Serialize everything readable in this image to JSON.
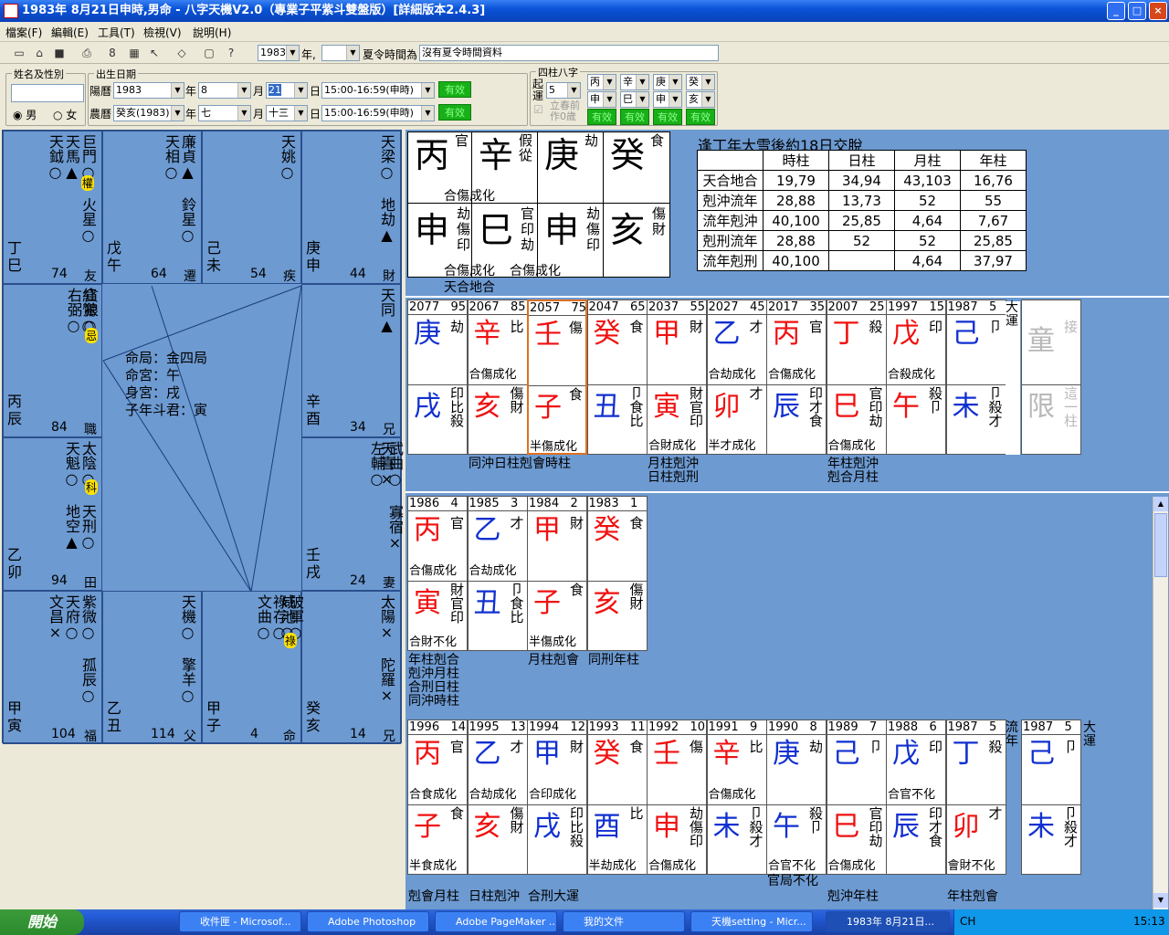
{
  "window": {
    "title": "1983年 8月21日申時,男命 - 八字天機V2.0（專業子平紫斗雙盤版）[詳細版本2.4.3]"
  },
  "menu": [
    "檔案(F)",
    "編輯(E)",
    "工具(T)",
    "檢視(V)",
    "說明(H)"
  ],
  "toolbar": {
    "year_value": "1983",
    "year_suffix": "年,",
    "dst_label": "夏令時間為",
    "dst_value": "沒有夏令時間資料"
  },
  "form": {
    "name_group": "姓名及性別",
    "birth_group": "出生日期",
    "gender_male": "男",
    "gender_female": "女",
    "solar_label": "陽曆",
    "solar_year": "1983",
    "solar_month": "8",
    "solar_day": "21",
    "solar_time": "15:00-16:59(申時)",
    "lunar_label": "農曆",
    "lunar_year": "癸亥(1983)",
    "lunar_month": "七",
    "lunar_day": "十三",
    "lunar_time": "15:00-16:59(申時)",
    "year_char": "年",
    "month_char": "月",
    "day_char": "日",
    "valid": "有效",
    "pillar_group": "四柱八字",
    "qiyun_label": "起運",
    "qiyun_value": "5",
    "lichun_label": "立春前",
    "zuo0_label": "作0歲",
    "pillars": [
      "丙",
      "辛",
      "庚",
      "癸",
      "申",
      "巳",
      "申",
      "亥"
    ]
  },
  "ziwei": {
    "center": [
      "命局：金四局",
      "命宮：午",
      "身宮：戌",
      "子年斗君：寅"
    ],
    "palaces": [
      {
        "stem": "丁巳",
        "num": "74",
        "name": "友",
        "stars": [
          "天鉞○",
          "天馬▲",
          "巨門○"
        ],
        "star2": "權",
        "star3": "火星○"
      },
      {
        "stem": "戊午",
        "num": "64",
        "name": "遷",
        "stars": [
          "天相○",
          "廉貞▲"
        ],
        "star3": "鈴星○"
      },
      {
        "stem": "己未",
        "num": "54",
        "name": "疾",
        "stars": [
          "天姚○"
        ]
      },
      {
        "stem": "庚申",
        "num": "44",
        "name": "財",
        "stars": [
          "天梁○"
        ],
        "star3": "地劫▲"
      },
      {
        "stem": "丙辰",
        "num": "84",
        "name": "職",
        "stars": [
          "紅鸞○"
        ]
      },
      {
        "stem": "辛酉",
        "num": "34",
        "name": "兄",
        "stars": [
          "天同▲"
        ]
      },
      {
        "stem": "乙卯",
        "num": "94",
        "name": "田",
        "stars": [
          "天魁○",
          "太陰○"
        ],
        "star3": "天刑○",
        "star4": "地空▲"
      },
      {
        "stem": "壬戌",
        "num": "24",
        "name": "妻",
        "stars": [
          "天喜×"
        ]
      },
      {
        "stem": "甲寅",
        "num": "104",
        "name": "福",
        "stars": [
          "文昌×",
          "天府○",
          "紫微○"
        ],
        "star3": "孤辰○"
      },
      {
        "stem": "乙丑",
        "num": "114",
        "name": "父",
        "stars": [
          "天機○"
        ],
        "star3": "擎羊○"
      },
      {
        "stem": "甲子",
        "num": "4",
        "name": "命",
        "stars": [
          "咸池○"
        ]
      },
      {
        "stem": "癸亥",
        "num": "14",
        "name": "兄",
        "stars": [
          "太陽×"
        ],
        "star3": "陀羅×"
      }
    ],
    "extra": {
      "youbi": "右弼○",
      "tanlang": "貪狼○",
      "ji": "忌",
      "ke": "科",
      "lu": "祿",
      "wuqu": "武曲○",
      "zuofu": "左輔○",
      "guashu": "寡宿×",
      "wenqu": "文曲○",
      "lucun": "祿存○",
      "pojun": "破軍○"
    }
  },
  "natal": {
    "top": [
      {
        "g": "丙",
        "s": "官"
      },
      {
        "g": "辛",
        "s": "假從"
      },
      {
        "g": "庚",
        "s": "劫"
      },
      {
        "g": "癸",
        "s": "食"
      }
    ],
    "bottom": [
      {
        "z": "申",
        "s": "劫傷印"
      },
      {
        "z": "巳",
        "s": "官印劫"
      },
      {
        "z": "申",
        "s": "劫傷印"
      },
      {
        "z": "亥",
        "s": "傷財"
      }
    ],
    "rel_top": "合傷成化",
    "rel_bottom1": "合傷成化",
    "rel_bottom2": "合傷成化",
    "note": "天合地合"
  },
  "jiaoyun": "逢丁年大雪後約18日交脫",
  "pillar_table": {
    "headers": [
      "",
      "時柱",
      "日柱",
      "月柱",
      "年柱"
    ],
    "rows": [
      [
        "天合地合",
        "19,79",
        "34,94",
        "43,103",
        "16,76"
      ],
      [
        "剋沖流年",
        "28,88",
        "13,73",
        "52",
        "55"
      ],
      [
        "流年剋沖",
        "40,100",
        "25,85",
        "4,64",
        "7,67"
      ],
      [
        "剋刑流年",
        "28,88",
        "52",
        "52",
        "25,85"
      ],
      [
        "流年剋刑",
        "40,100",
        "",
        "4,64",
        "37,97"
      ]
    ]
  },
  "dayun_label": "大運",
  "dayun": [
    {
      "y": "2077",
      "a": "95",
      "g": "庚",
      "gc": "blue",
      "s": "劫",
      "z": "戌",
      "zc": "blue",
      "h": "印比殺",
      "r1": "",
      "r2": ""
    },
    {
      "y": "2067",
      "a": "85",
      "g": "辛",
      "gc": "red",
      "s": "比",
      "z": "亥",
      "zc": "red",
      "h": "傷財",
      "r1": "合傷成化",
      "r2": ""
    },
    {
      "y": "2057",
      "a": "75",
      "g": "壬",
      "gc": "red",
      "s": "傷",
      "z": "子",
      "zc": "red",
      "h": "食",
      "r1": "",
      "r2": "半傷成化"
    },
    {
      "y": "2047",
      "a": "65",
      "g": "癸",
      "gc": "red",
      "s": "食",
      "z": "丑",
      "zc": "blue",
      "h": "卩食比",
      "r1": "",
      "r2": ""
    },
    {
      "y": "2037",
      "a": "55",
      "g": "甲",
      "gc": "red",
      "s": "財",
      "z": "寅",
      "zc": "red",
      "h": "財官印",
      "r1": "",
      "r2": "合財成化"
    },
    {
      "y": "2027",
      "a": "45",
      "g": "乙",
      "gc": "blue",
      "s": "才",
      "z": "卯",
      "zc": "red",
      "h": "才",
      "r1": "合劫成化",
      "r2": "半才成化"
    },
    {
      "y": "2017",
      "a": "35",
      "g": "丙",
      "gc": "red",
      "s": "官",
      "z": "辰",
      "zc": "blue",
      "h": "印才食",
      "r1": "合傷成化",
      "r2": ""
    },
    {
      "y": "2007",
      "a": "25",
      "g": "丁",
      "gc": "red",
      "s": "殺",
      "z": "巳",
      "zc": "red",
      "h": "官印劫",
      "r1": "",
      "r2": "合傷成化"
    },
    {
      "y": "1997",
      "a": "15",
      "g": "戊",
      "gc": "red",
      "s": "印",
      "z": "午",
      "zc": "red",
      "h": "殺卩",
      "r1": "合殺成化",
      "r2": ""
    },
    {
      "y": "1987",
      "a": "5",
      "g": "己",
      "gc": "blue",
      "s": "卩",
      "z": "未",
      "zc": "blue",
      "h": "卩殺才",
      "r1": "",
      "r2": ""
    }
  ],
  "dayun_tongxian": {
    "g": "童",
    "s": "接",
    "z": "限",
    "h": "這一柱"
  },
  "dayun_notes": [
    "同沖日柱剋會時柱",
    "月柱剋沖",
    "日柱剋刑",
    "年柱剋沖",
    "剋合月柱"
  ],
  "xiaoyun": [
    {
      "y": "1986",
      "a": "4",
      "g": "丙",
      "gc": "red",
      "s": "官",
      "z": "寅",
      "zc": "red",
      "h": "財官印",
      "r1": "合傷成化",
      "r2": "合財不化"
    },
    {
      "y": "1985",
      "a": "3",
      "g": "乙",
      "gc": "blue",
      "s": "才",
      "z": "丑",
      "zc": "blue",
      "h": "卩食比",
      "r1": "合劫成化",
      "r2": ""
    },
    {
      "y": "1984",
      "a": "2",
      "g": "甲",
      "gc": "red",
      "s": "財",
      "z": "子",
      "zc": "red",
      "h": "食",
      "r1": "",
      "r2": "半傷成化"
    },
    {
      "y": "1983",
      "a": "1",
      "g": "癸",
      "gc": "red",
      "s": "食",
      "z": "亥",
      "zc": "red",
      "h": "傷財",
      "r1": "",
      "r2": ""
    }
  ],
  "xiaoyun_notes": [
    "年柱剋合",
    "剋沖月柱",
    "合刑日柱",
    "同沖時柱",
    "月柱剋會",
    "同刑年柱"
  ],
  "liunian_label": "流年",
  "liunian": [
    {
      "y": "1996",
      "a": "14",
      "g": "丙",
      "gc": "red",
      "s": "官",
      "z": "子",
      "zc": "red",
      "h": "食",
      "r1": "合食成化",
      "r2": "半食成化"
    },
    {
      "y": "1995",
      "a": "13",
      "g": "乙",
      "gc": "blue",
      "s": "才",
      "z": "亥",
      "zc": "red",
      "h": "傷財",
      "r1": "合劫成化",
      "r2": ""
    },
    {
      "y": "1994",
      "a": "12",
      "g": "甲",
      "gc": "blue",
      "s": "財",
      "z": "戌",
      "zc": "blue",
      "h": "印比殺",
      "r1": "合印成化",
      "r2": ""
    },
    {
      "y": "1993",
      "a": "11",
      "g": "癸",
      "gc": "red",
      "s": "食",
      "z": "酉",
      "zc": "blue",
      "h": "比",
      "r1": "",
      "r2": "半劫成化"
    },
    {
      "y": "1992",
      "a": "10",
      "g": "壬",
      "gc": "red",
      "s": "傷",
      "z": "申",
      "zc": "red",
      "h": "劫傷印",
      "r1": "",
      "r2": "合傷成化"
    },
    {
      "y": "1991",
      "a": "9",
      "g": "辛",
      "gc": "red",
      "s": "比",
      "z": "未",
      "zc": "blue",
      "h": "卩殺才",
      "r1": "合傷成化",
      "r2": ""
    },
    {
      "y": "1990",
      "a": "8",
      "g": "庚",
      "gc": "blue",
      "s": "劫",
      "z": "午",
      "zc": "blue",
      "h": "殺卩",
      "r1": "",
      "r2": "合官不化"
    },
    {
      "y": "1989",
      "a": "7",
      "g": "己",
      "gc": "blue",
      "s": "卩",
      "z": "巳",
      "zc": "red",
      "h": "官印劫",
      "r1": "",
      "r2": "合傷成化"
    },
    {
      "y": "1988",
      "a": "6",
      "g": "戊",
      "gc": "blue",
      "s": "印",
      "z": "辰",
      "zc": "blue",
      "h": "印才食",
      "r1": "合官不化",
      "r2": ""
    },
    {
      "y": "1987",
      "a": "5",
      "g": "丁",
      "gc": "blue",
      "s": "殺",
      "z": "卯",
      "zc": "red",
      "h": "才",
      "r1": "",
      "r2": "會財不化"
    }
  ],
  "liunian_extra": {
    "y": "1987",
    "a": "5",
    "g": "己",
    "s": "卩",
    "z": "未",
    "h": "卩殺才"
  },
  "liunian_notes": [
    "剋會月柱",
    "日柱剋沖",
    "合刑大運",
    "官局不化",
    "剋沖年柱",
    "年柱剋會"
  ],
  "taskbar": {
    "start": "開始",
    "tasks": [
      "收件匣 - Microsof...",
      "Adobe Photoshop",
      "Adobe PageMaker ...",
      "我的文件",
      "天機setting - Micr...",
      "1983年 8月21日..."
    ],
    "lang": "CH",
    "clock": "15:13"
  }
}
